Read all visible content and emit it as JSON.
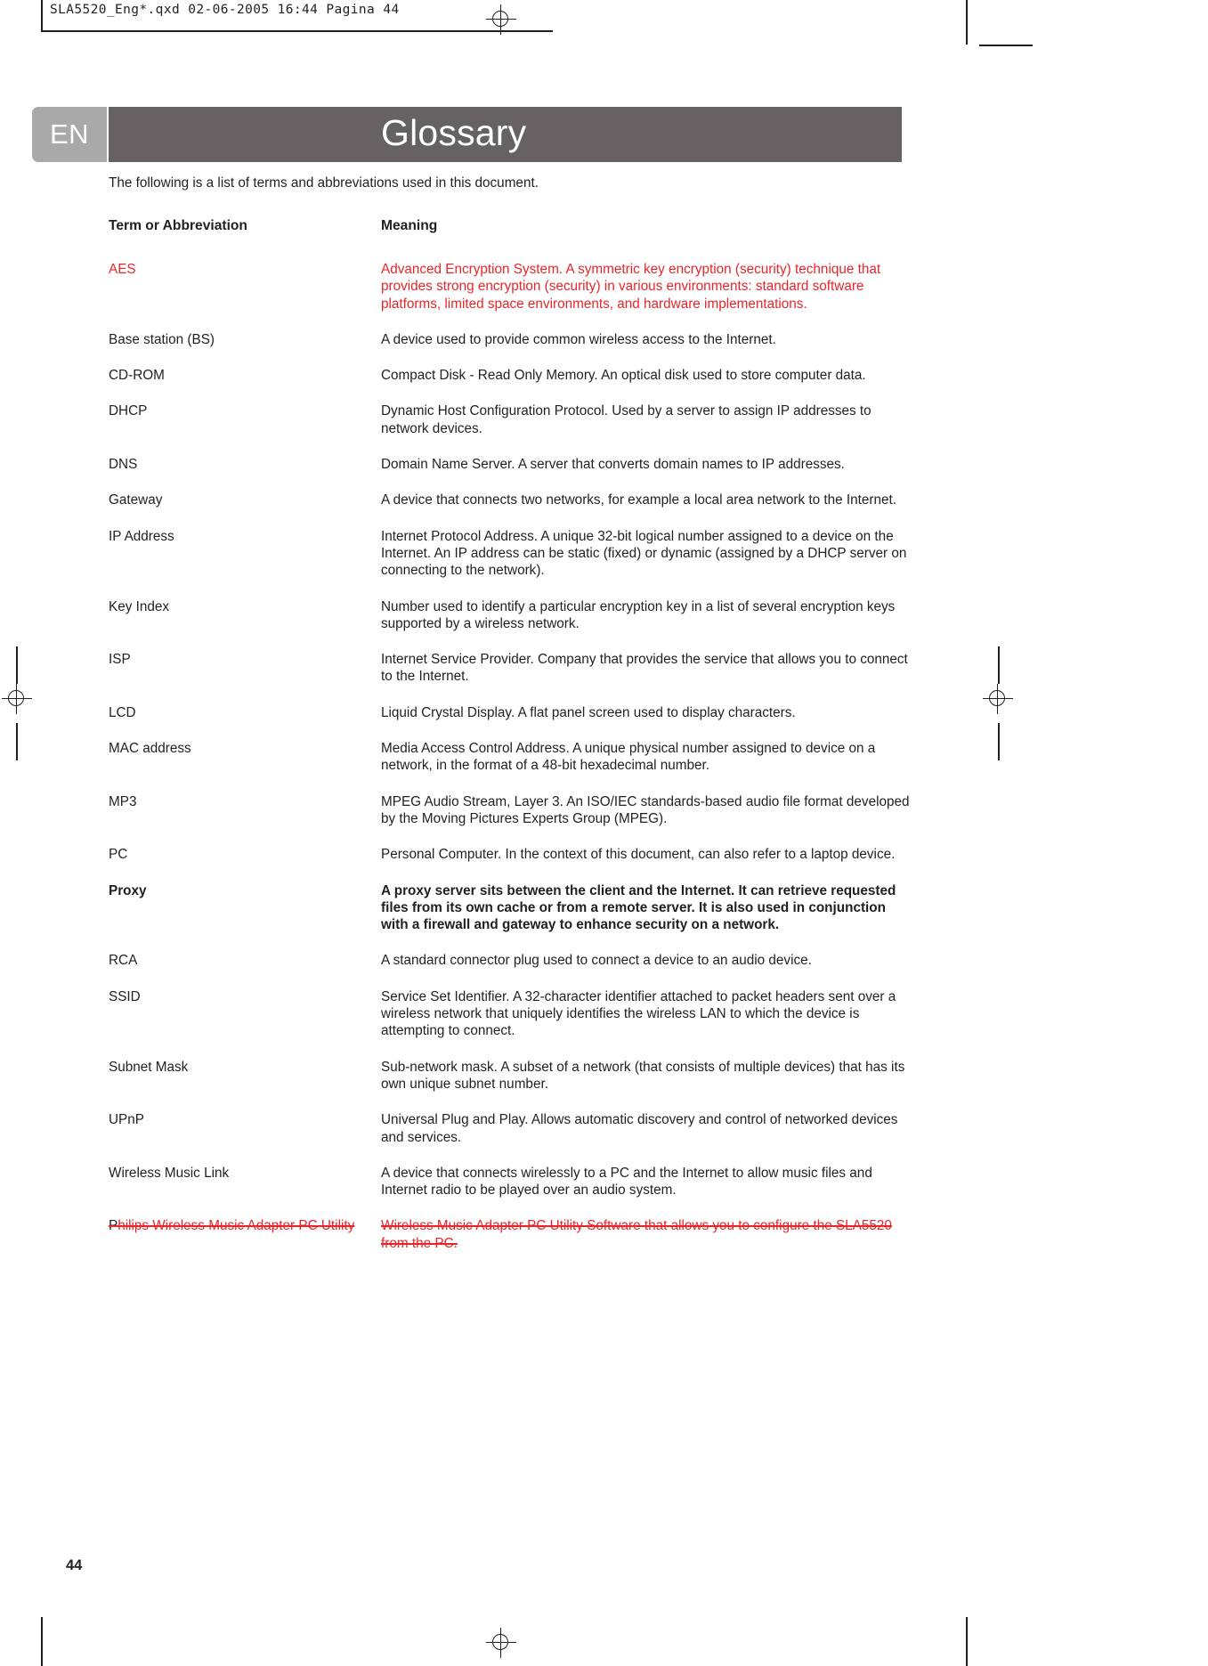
{
  "print_marks": {
    "slug_text": "SLA5520_Eng*.qxd  02-06-2005  16:44  Pagina 44"
  },
  "header": {
    "language_badge": "EN",
    "title": "Glossary"
  },
  "body": {
    "intro": "The following is a list of terms and abbreviations used in this document.",
    "columns": {
      "term": "Term or Abbreviation",
      "meaning": "Meaning"
    },
    "entries": [
      {
        "term": "AES",
        "meaning": "Advanced Encryption System. A symmetric key encryption (security) technique that provides strong encryption (security) in various environments: standard software platforms, limited space environments, and hardware implementations.",
        "style": "red"
      },
      {
        "term": "Base station (BS)",
        "meaning": "A device used to provide common wireless access to the Internet.",
        "style": "normal"
      },
      {
        "term": "CD-ROM",
        "meaning": "Compact Disk - Read Only Memory. An optical disk used to store computer data.",
        "style": "normal"
      },
      {
        "term": "DHCP",
        "meaning": "Dynamic Host Configuration Protocol. Used by a server to assign IP  addresses to network devices.",
        "style": "normal"
      },
      {
        "term": "DNS",
        "meaning": "Domain Name Server. A server that converts domain names to IP addresses.",
        "style": "normal"
      },
      {
        "term": "Gateway",
        "meaning": "A device that connects two networks, for example a local area network  to the Internet.",
        "style": "normal"
      },
      {
        "term": "IP Address",
        "meaning": "Internet Protocol Address. A unique 32-bit logical number assigned to a device on the Internet. An IP address can be static (fixed) or dynamic (assigned by a DHCP server on connecting to the network).",
        "style": "normal"
      },
      {
        "term": "Key Index",
        "meaning": "Number used to identify a particular encryption key in a list of several encryption keys supported by a wireless network.",
        "style": "normal"
      },
      {
        "term": "ISP",
        "meaning": "Internet Service Provider. Company that provides the service that allows you to connect to the Internet.",
        "style": "normal"
      },
      {
        "term": "LCD",
        "meaning": "Liquid Crystal Display. A flat panel screen used to display characters.",
        "style": "normal"
      },
      {
        "term": "MAC address",
        "meaning": "Media Access Control Address. A unique physical number assigned to device on a network, in the format of a 48-bit hexadecimal number.",
        "style": "normal"
      },
      {
        "term": "MP3",
        "meaning": "MPEG Audio Stream, Layer 3. An ISO/IEC standards-based audio file format developed by the Moving Pictures Experts Group (MPEG).",
        "style": "normal"
      },
      {
        "term": "PC",
        "meaning": "Personal Computer. In the context of this document, can also refer to a laptop device.",
        "style": "normal"
      },
      {
        "term": "Proxy",
        "meaning": "A proxy server sits between the client and the Internet. It can retrieve requested files from its own cache or from a remote server. It is also used in conjunction with a firewall and gateway to enhance security on a network.",
        "style": "bold"
      },
      {
        "term": "RCA",
        "meaning": "A standard connector plug used to connect a device to an audio device.",
        "style": "normal"
      },
      {
        "term": "SSID",
        "meaning": "Service Set Identifier. A 32-character identifier attached to packet headers sent over a wireless network that uniquely identifies the wireless LAN to which the device is attempting to connect.",
        "style": "normal"
      },
      {
        "term": "Subnet Mask",
        "meaning": "Sub-network mask. A subset of a network (that consists of multiple devices) that has its own unique subnet number.",
        "style": "normal"
      },
      {
        "term": "UPnP",
        "meaning": "Universal Plug and Play. Allows automatic discovery and control of networked devices and services.",
        "style": "normal"
      },
      {
        "term": "Wireless Music Link",
        "meaning": "A device that connects wirelessly to a PC and the Internet to allow music files and Internet radio to be played over an audio system.",
        "style": "normal"
      },
      {
        "term": "Philips Wireless Music Adapter PC Utility",
        "term_lead": "P",
        "term_rest": "hilips Wireless Music Adapter PC Utility",
        "meaning": "Wireless Music Adapter PC Utility Software that allows you to configure the SLA5520 from the PC.",
        "style": "struck"
      }
    ]
  },
  "footer": {
    "page_number": "44"
  },
  "colors": {
    "accent_red": "#e8262a",
    "title_bar": "#666163",
    "badge_gray": "#a9a9a9",
    "text": "#231f20"
  }
}
